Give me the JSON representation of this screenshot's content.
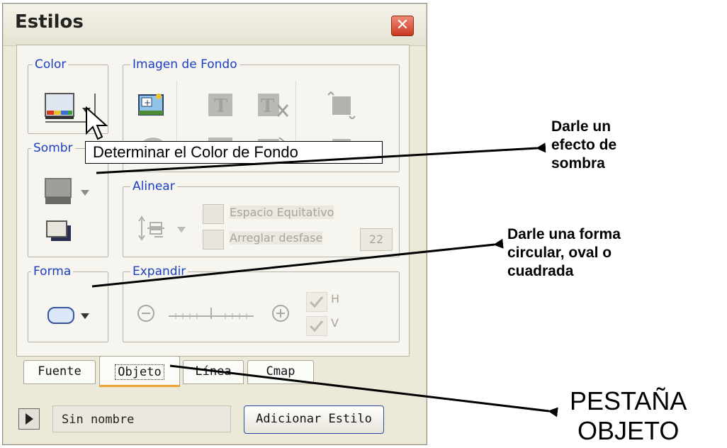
{
  "window": {
    "title": "Estilos",
    "close_symbol": "✕"
  },
  "groups": {
    "color": "Color",
    "imagen": "Imagen de Fondo",
    "sombra": "Sombr",
    "alinear": "Alinear",
    "forma": "Forma",
    "expandir": "Expandir"
  },
  "alinear": {
    "espacio_label": "Espacio Equitativo",
    "arreglar_label": "Arreglar desfase",
    "offset_value": "22"
  },
  "expandir": {
    "h_label": "H",
    "v_label": "V"
  },
  "tooltip": "Determinar el Color de Fondo",
  "tabs": [
    "Fuente",
    "Objeto",
    "Línea",
    "Cmap"
  ],
  "bottom": {
    "style_name": "Sin nombre",
    "add_button": "Adicionar Estilo"
  },
  "annotations": {
    "sombra": [
      "Darle un",
      "efecto de",
      "sombra"
    ],
    "forma": [
      "Darle una forma",
      "circular, oval o",
      "cuadrada"
    ],
    "pestana": [
      "PESTAÑA",
      "OBJETO"
    ]
  },
  "icons": [
    "color-picker-icon",
    "background-image-icon",
    "text-overlay-icon",
    "crop-icon",
    "shadow-icon",
    "shadow-color-icon",
    "align-icon",
    "shape-icon",
    "zoom-out-icon",
    "zoom-in-icon",
    "play-icon"
  ]
}
